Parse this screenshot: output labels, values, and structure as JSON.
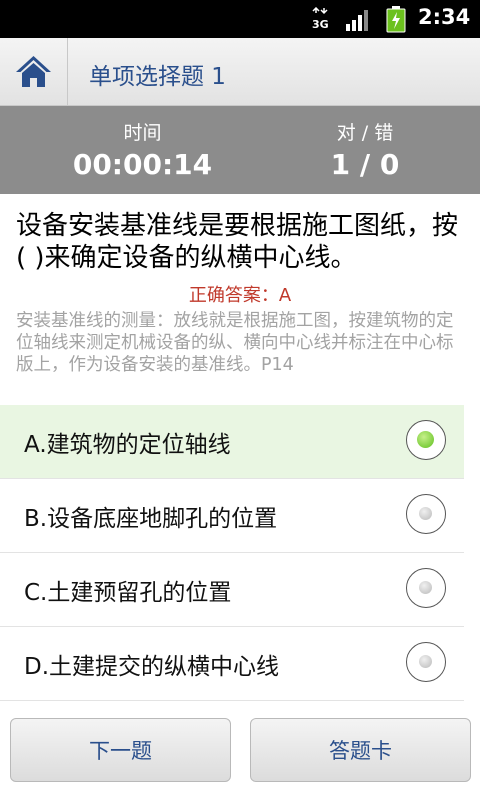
{
  "status_bar": {
    "network_label": "3G",
    "time": "2:34",
    "signal_icon": "signal-icon",
    "battery_icon": "battery-charging-icon"
  },
  "header": {
    "home_icon": "home-icon",
    "title": "单项选择题 1"
  },
  "stats": {
    "time_label": "时间",
    "time_value": "00:00:14",
    "score_label": "对 / 错",
    "score_value": "1 / 0"
  },
  "question": {
    "text": "设备安装基准线是要根据施工图纸，按( )来确定设备的纵横中心线。",
    "answer": "正确答案：A",
    "explanation": "安装基准线的测量：放线就是根据施工图，按建筑物的定位轴线来测定机械设备的纵、横向中心线并标注在中心标版上，作为设备安装的基准线。P14"
  },
  "options": [
    {
      "label": "A.建筑物的定位轴线",
      "selected": true
    },
    {
      "label": "B.设备底座地脚孔的位置",
      "selected": false
    },
    {
      "label": "C.土建预留孔的位置",
      "selected": false
    },
    {
      "label": "D.土建提交的纵横中心线",
      "selected": false
    }
  ],
  "buttons": {
    "next": "下一题",
    "answer_card": "答题卡"
  },
  "colors": {
    "accent": "#2a4f8c",
    "answer_red": "#c0392b",
    "selected_bg": "#e9f6e2",
    "radio_green": "#5fbf1e"
  }
}
